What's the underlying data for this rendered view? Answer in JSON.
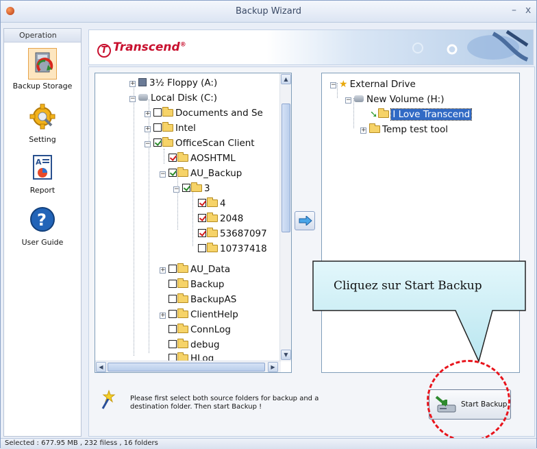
{
  "window": {
    "title": "Backup Wizard",
    "minimize": "–",
    "close": "x"
  },
  "sidebar": {
    "header": "Operation",
    "items": [
      {
        "label": "Backup Storage",
        "icon": "backup-storage-icon",
        "active": true
      },
      {
        "label": "Setting",
        "icon": "gear-icon"
      },
      {
        "label": "Report",
        "icon": "report-icon"
      },
      {
        "label": "User Guide",
        "icon": "help-icon"
      }
    ]
  },
  "header": {
    "logo_text": "Transcend",
    "logo_mark": "®",
    "logo_symbol": "T"
  },
  "source_tree": {
    "nodes": [
      {
        "label": "3½ Floppy (A:)"
      },
      {
        "label": "Local Disk (C:)"
      },
      {
        "label": "Documents and Se"
      },
      {
        "label": "Intel"
      },
      {
        "label": "OfficeScan Client"
      },
      {
        "label": "AOSHTML"
      },
      {
        "label": "AU_Backup"
      },
      {
        "label": "3"
      },
      {
        "label": "4"
      },
      {
        "label": "2048"
      },
      {
        "label": "53687097"
      },
      {
        "label": "10737418"
      },
      {
        "label": "AU_Data"
      },
      {
        "label": "Backup"
      },
      {
        "label": "BackupAS"
      },
      {
        "label": "ClientHelp"
      },
      {
        "label": "ConnLog"
      },
      {
        "label": "debug"
      },
      {
        "label": "HLog"
      }
    ]
  },
  "dest_tree": {
    "nodes": [
      {
        "label": "External Drive"
      },
      {
        "label": "New Volume (H:)"
      },
      {
        "label": "I Love Transcend"
      },
      {
        "label": "Temp test tool"
      }
    ]
  },
  "footer": {
    "message_line1": "Please first select both source folders for backup and a",
    "message_line2": "destination folder. Then start Backup !",
    "start_button": "Start Backup"
  },
  "callout": {
    "text": "Cliquez sur Start Backup"
  },
  "status": {
    "text": "Selected : 677.95 MB , 232 filess , 16 folders"
  },
  "colors": {
    "accent": "#316ac5",
    "brand": "#c8102e",
    "highlight_circle": "#e8141c"
  }
}
